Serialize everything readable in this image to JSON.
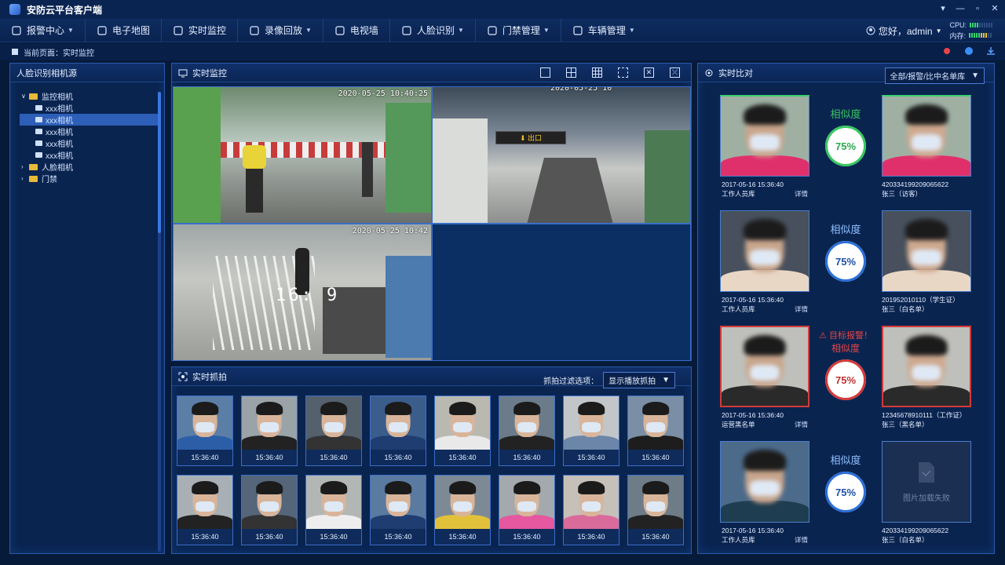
{
  "app": {
    "title": "安防云平台客户端"
  },
  "menu": [
    {
      "label": "报警中心",
      "icon": "alarm-icon",
      "dropdown": true
    },
    {
      "label": "电子地图",
      "icon": "map-pin-icon",
      "dropdown": false
    },
    {
      "label": "实时监控",
      "icon": "camera-icon",
      "dropdown": false
    },
    {
      "label": "录像回放",
      "icon": "playback-icon",
      "dropdown": true
    },
    {
      "label": "电视墙",
      "icon": "tv-wall-icon",
      "dropdown": false
    },
    {
      "label": "人脸识别",
      "icon": "face-scan-icon",
      "dropdown": true
    },
    {
      "label": "门禁管理",
      "icon": "door-icon",
      "dropdown": true
    },
    {
      "label": "车辆管理",
      "icon": "car-icon",
      "dropdown": true
    }
  ],
  "user": {
    "greeting": "您好，admin",
    "cpu_label": "CPU:",
    "mem_label": "内存:"
  },
  "breadcrumb": {
    "text": "当前页面：实时监控"
  },
  "left_panel": {
    "title": "人脸识别相机源",
    "tree": [
      {
        "label": "监控相机",
        "level": 0,
        "expanded": true
      },
      {
        "label": "xxx相机",
        "level": 1,
        "selected": false
      },
      {
        "label": "xxx相机",
        "level": 1,
        "selected": true
      },
      {
        "label": "xxx相机",
        "level": 1,
        "selected": false
      },
      {
        "label": "xxx相机",
        "level": 1,
        "selected": false
      },
      {
        "label": "xxx相机",
        "level": 1,
        "selected": false
      },
      {
        "label": "人脸相机",
        "level": 0,
        "expanded": false
      },
      {
        "label": "门禁",
        "level": 0,
        "expanded": false
      }
    ]
  },
  "video_panel": {
    "title": "实时监控",
    "cells": [
      {
        "timestamp": "2020-05-25 10:40:25"
      },
      {
        "timestamp": "2020-05-25 10",
        "sign": "⬇ 出口"
      },
      {
        "timestamp": "2020-05-25 10:42",
        "overlay": "16:  9"
      }
    ]
  },
  "snap_panel": {
    "title": "实时抓拍",
    "filter_label": "抓拍过滤选项：",
    "filter_value": "显示播放抓拍",
    "cards": [
      "15:36:40",
      "15:36:40",
      "15:36:40",
      "15:36:40",
      "15:36:40",
      "15:36:40",
      "15:36:40",
      "15:36:40",
      "15:36:40",
      "15:36:40",
      "15:36:40",
      "15:36:40",
      "15:36:40",
      "15:36:40",
      "15:36:40",
      "15:36:40"
    ]
  },
  "compare_panel": {
    "title": "实时比对",
    "filter_value": "全部/报警/比中名单库",
    "similarity_label": "相似度",
    "alarm_label": "⚠ 目标报警！",
    "detail_link": "详情",
    "load_fail": "图片加载失败",
    "rows": [
      {
        "score": "75%",
        "time": "2017-05-16  15:36:40",
        "lib": "工作人员库",
        "id": "420334199209065622",
        "name": "张三（访客）",
        "alarm": false,
        "green": true
      },
      {
        "score": "75%",
        "time": "2017-05-16  15:36:40",
        "lib": "工作人员库",
        "id": "201952010110（学生证）",
        "name": "张三（白名单）",
        "alarm": false,
        "green": false
      },
      {
        "score": "75%",
        "time": "2017-05-16  15:36:40",
        "lib": "运营黑名单",
        "id": "12345678910111（工作证）",
        "name": "张三（黑名单）",
        "alarm": true,
        "green": false
      },
      {
        "score": "75%",
        "time": "2017-05-16  15:36:40",
        "lib": "工作人员库",
        "id": "420334199209065622",
        "name": "张三（白名单）",
        "alarm": false,
        "green": false,
        "failed": true
      }
    ]
  },
  "colors": {
    "accent": "#2a5aa8",
    "alarm": "#d33a3a",
    "ok": "#37c85f"
  }
}
